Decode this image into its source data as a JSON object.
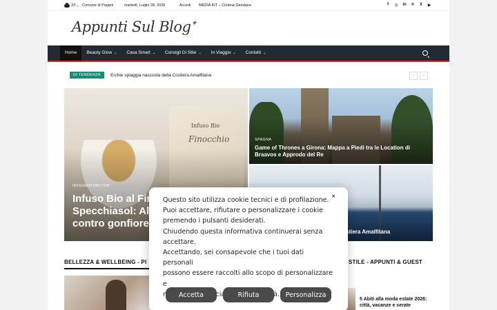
{
  "topbar": {
    "temperature": "33",
    "unit": "C",
    "location": "Comune di Pagani",
    "date": "martedì, Luglio 28, 2026",
    "login": "Accedi",
    "media_kit": "MEDIA KIT – Cristina Giordano",
    "social_icons": [
      "facebook-icon",
      "instagram-icon",
      "linkedin-icon",
      "pinterest-icon",
      "x-icon",
      "youtube-icon"
    ]
  },
  "header": {
    "logo_text": "Appunti Sul Blog"
  },
  "nav": {
    "items": [
      {
        "label": "Home",
        "caret": ""
      },
      {
        "label": "Beauty Glow",
        "caret": "⌄"
      },
      {
        "label": "Casa Smart",
        "caret": "⌄"
      },
      {
        "label": "Consigli Di Stile",
        "caret": "⌄"
      },
      {
        "label": "In Viaggio",
        "caret": "⌄"
      },
      {
        "label": "Contatti",
        "caret": "⌄"
      }
    ]
  },
  "trending": {
    "badge": "DI TENDENZA",
    "headline": "Erchie spiaggia nascosta della Costiera Amalfitana",
    "prev": "‹",
    "next": "›"
  },
  "hero": {
    "main": {
      "category": "INTEGRATORI TOP",
      "title_line1": "Infuso Bio al Fin",
      "title_line2": "Specchiasol: All",
      "title_line3": "contro gonfiore",
      "box_label1": "Infuso Bio",
      "box_label2": "Finocchio"
    },
    "top_right": {
      "category": "SPAGNA",
      "title": "Game of Thrones a Girona: Mappa a Piedi tra le Location di Braavos e Approdo del Re"
    },
    "bottom_right": {
      "title": "stiera Amalfitana"
    }
  },
  "sections": {
    "left_title": "BELLEZZA & WELLBEING - PI",
    "left_icon": "",
    "right_title": "STILE - APPUNTI & GUEST",
    "right_post": "5 Abiti alla moda estate 2026: città, vacanze e serate"
  },
  "cookie": {
    "lines": [
      "Questo sito utilizza cookie tecnici e di profilazione.",
      "Puoi accettare, rifiutare o personalizzare i cookie",
      "premendo i pulsanti desiderati.",
      "Chiudendo questa informativa continuerai senza",
      "accettare.",
      "Accettando, sei consapevole che i tuoi dati personali",
      "possono essere raccolti allo scopo di personalizzare e",
      "misurare l'efficacia della pubblicità."
    ],
    "close": "×",
    "accept": "Accetta",
    "reject": "Rifiuta",
    "customize": "Personalizza"
  }
}
